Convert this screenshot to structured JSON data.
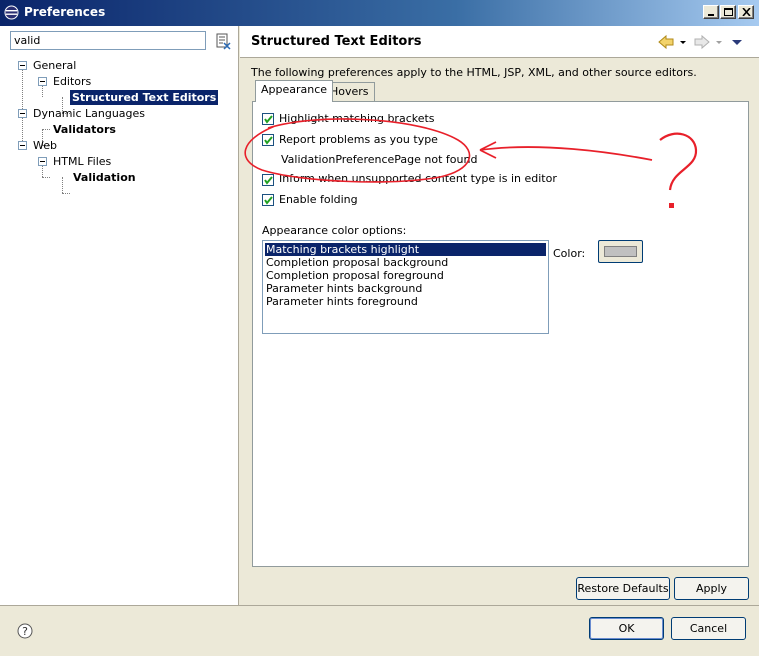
{
  "window": {
    "title": "Preferences"
  },
  "filter": {
    "value": "valid"
  },
  "tree": {
    "general": "General",
    "editors": "Editors",
    "structured": "Structured Text Editors",
    "dynamic": "Dynamic Languages",
    "validators": "Validators",
    "web": "Web",
    "html_files": "HTML Files",
    "validation": "Validation"
  },
  "page": {
    "title": "Structured Text Editors",
    "description": "The following preferences apply to the HTML, JSP, XML, and other source editors.",
    "tabs": [
      "Appearance",
      "Hovers"
    ],
    "options": [
      {
        "label": "Highlight matching brackets",
        "checked": true
      },
      {
        "label": "Report problems as you type",
        "checked": true
      },
      {
        "label": "Inform when unsupported content type is in editor",
        "checked": true
      },
      {
        "label": "Enable folding",
        "checked": true
      }
    ],
    "error_text": "ValidationPreferencePage not found",
    "color_options_label": "Appearance color options:",
    "color_list": [
      "Matching brackets highlight",
      "Completion proposal background",
      "Completion proposal foreground",
      "Parameter hints background",
      "Parameter hints foreground"
    ],
    "color_label": "Color:",
    "swatch_color": "#c0c0c0"
  },
  "buttons": {
    "restore": "Restore Defaults",
    "apply": "Apply",
    "ok": "OK",
    "cancel": "Cancel"
  },
  "annotation": {
    "mark": "?",
    "color": "#e8202a"
  }
}
